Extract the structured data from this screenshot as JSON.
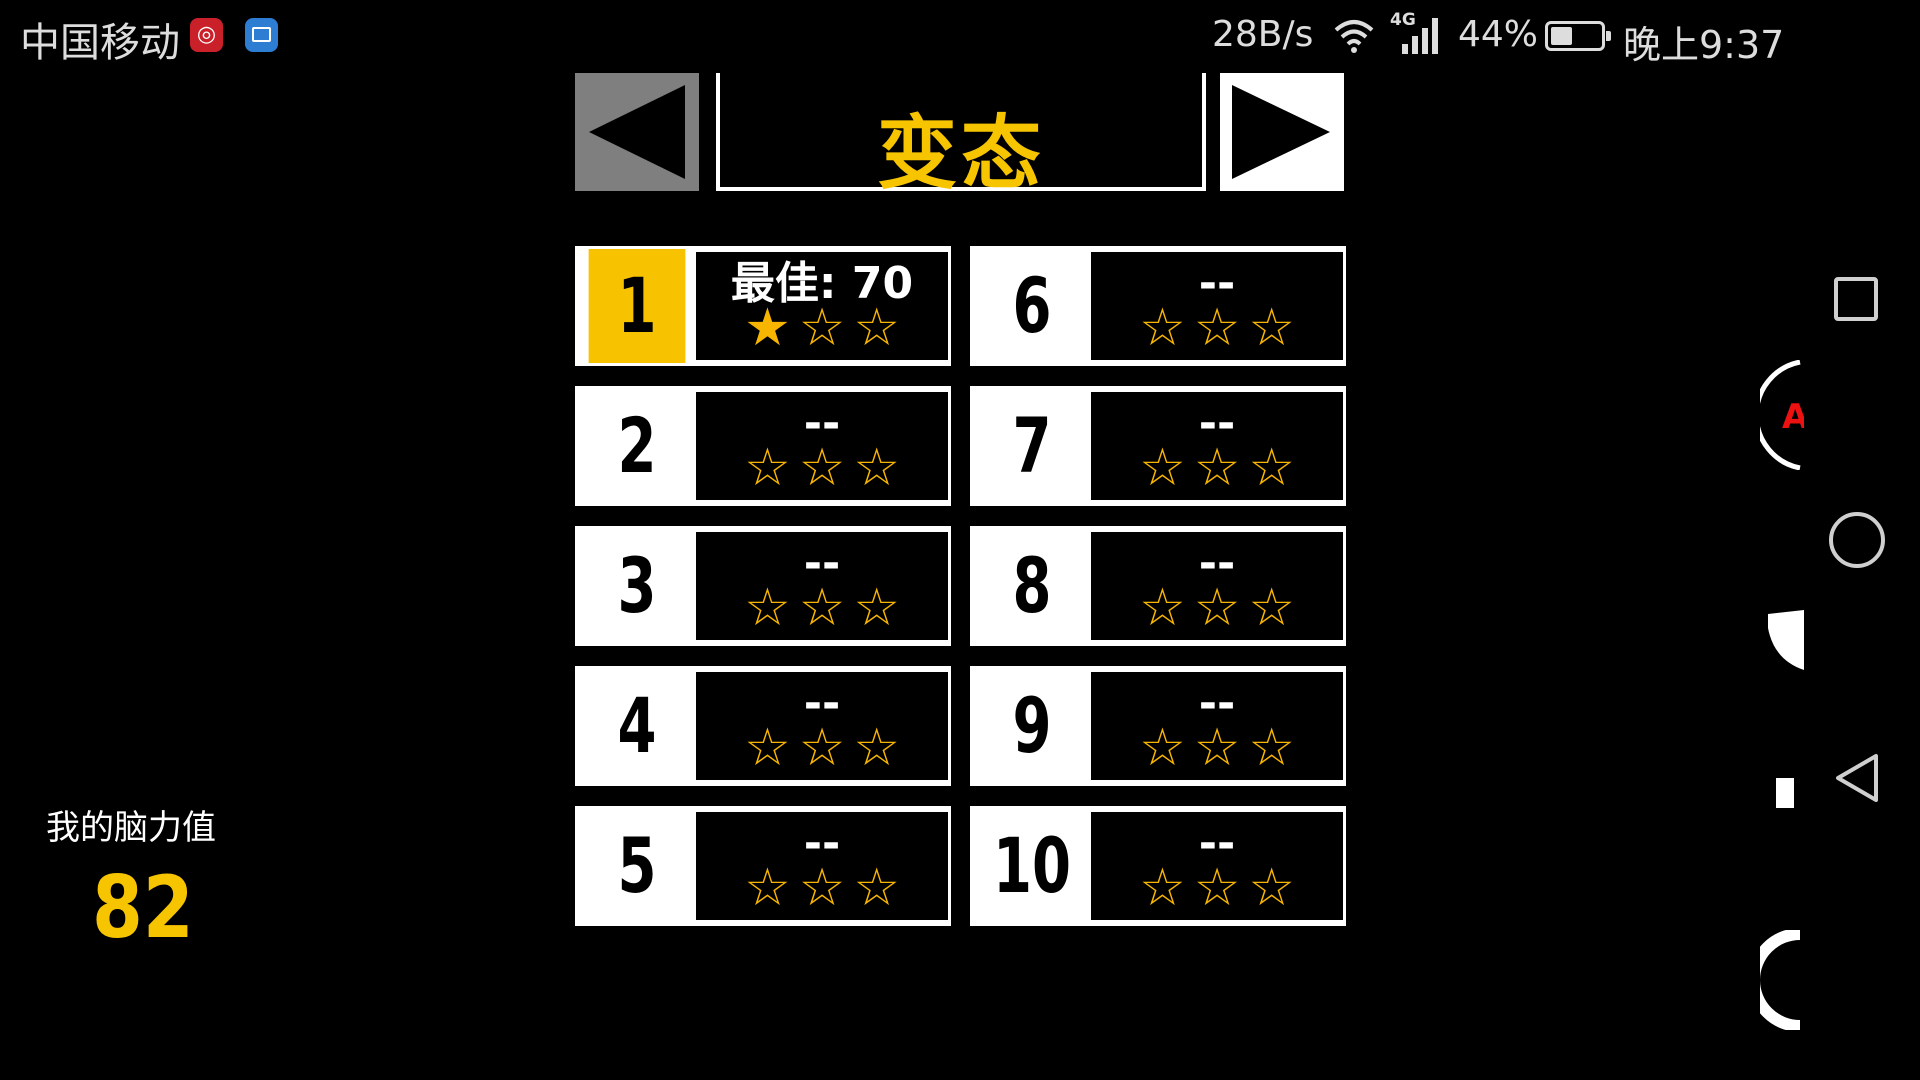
{
  "status_bar": {
    "carrier": "中国移动",
    "net_speed": "28B/s",
    "network_type": "4G",
    "battery_percent": "44%",
    "battery_level": 0.44,
    "time": "晚上9:37"
  },
  "header": {
    "title": "变态",
    "prev_icon": "triangle-left-icon",
    "next_icon": "triangle-right-icon"
  },
  "levels": [
    {
      "number": "1",
      "score": "最佳: 70",
      "stars_earned": 1,
      "stars_total": 3,
      "selected": true
    },
    {
      "number": "2",
      "score": "--",
      "stars_earned": 0,
      "stars_total": 3
    },
    {
      "number": "3",
      "score": "--",
      "stars_earned": 0,
      "stars_total": 3
    },
    {
      "number": "4",
      "score": "--",
      "stars_earned": 0,
      "stars_total": 3
    },
    {
      "number": "5",
      "score": "--",
      "stars_earned": 0,
      "stars_total": 3
    },
    {
      "number": "6",
      "score": "--",
      "stars_earned": 0,
      "stars_total": 3
    },
    {
      "number": "7",
      "score": "--",
      "stars_earned": 0,
      "stars_total": 3
    },
    {
      "number": "8",
      "score": "--",
      "stars_earned": 0,
      "stars_total": 3
    },
    {
      "number": "9",
      "score": "--",
      "stars_earned": 0,
      "stars_total": 3
    },
    {
      "number": "10",
      "score": "--",
      "stars_earned": 0,
      "stars_total": 3
    }
  ],
  "brain": {
    "label": "我的脑力值",
    "value": "82"
  },
  "colors": {
    "accent": "#f7c500",
    "star": "#f7b500",
    "background": "#000000"
  }
}
